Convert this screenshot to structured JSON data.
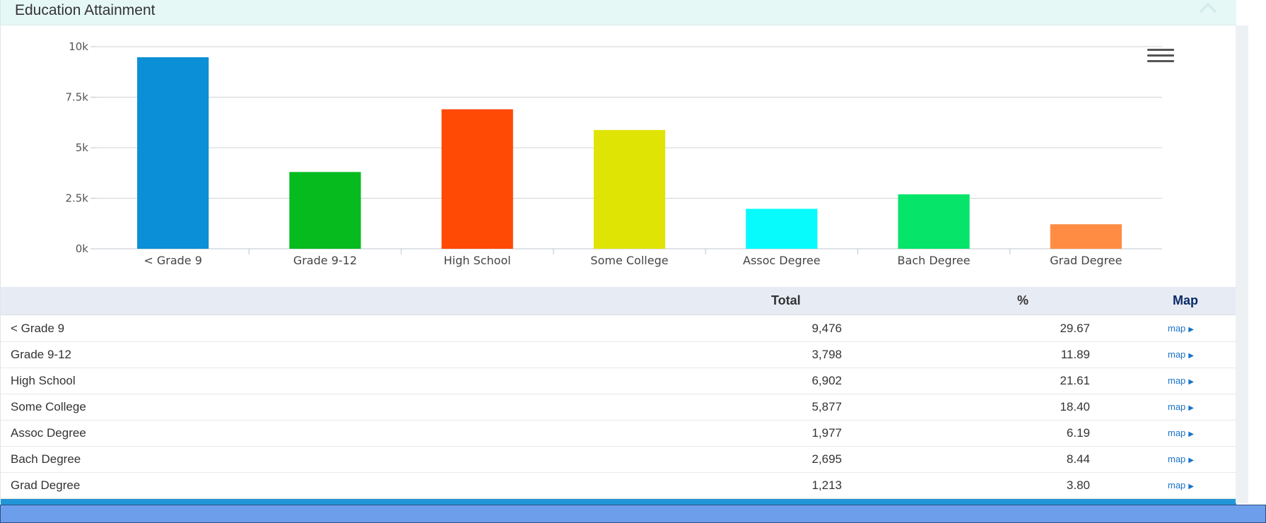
{
  "panel": {
    "title": "Education Attainment",
    "icons": {
      "collapse": "chevron-up-icon",
      "menu": "hamburger-menu-icon"
    }
  },
  "chart_data": {
    "type": "bar",
    "categories": [
      "< Grade 9",
      "Grade 9-12",
      "High School",
      "Some College",
      "Assoc Degree",
      "Bach Degree",
      "Grad Degree"
    ],
    "values": [
      9476,
      3798,
      6902,
      5877,
      1977,
      2695,
      1213
    ],
    "colors": [
      "#0b8fd6",
      "#05bb1e",
      "#ff4a05",
      "#dfe405",
      "#07fbfd",
      "#06e46a",
      "#ff8c42"
    ],
    "yticks": [
      0,
      2500,
      5000,
      7500,
      10000
    ],
    "ytick_labels": [
      "0k",
      "2.5k",
      "5k",
      "7.5k",
      "10k"
    ],
    "ylim": [
      0,
      10000
    ],
    "grid": true,
    "legend": "none"
  },
  "table": {
    "headers": {
      "name": "",
      "total": "Total",
      "pct": "%",
      "map": "Map"
    },
    "rows": [
      {
        "name": "< Grade 9",
        "total": "9,476",
        "pct": "29.67",
        "map": "map"
      },
      {
        "name": "Grade 9-12",
        "total": "3,798",
        "pct": "11.89",
        "map": "map"
      },
      {
        "name": "High School",
        "total": "6,902",
        "pct": "21.61",
        "map": "map"
      },
      {
        "name": "Some College",
        "total": "5,877",
        "pct": "18.40",
        "map": "map"
      },
      {
        "name": "Assoc Degree",
        "total": "1,977",
        "pct": "6.19",
        "map": "map"
      },
      {
        "name": "Bach Degree",
        "total": "2,695",
        "pct": "8.44",
        "map": "map"
      },
      {
        "name": "Grad Degree",
        "total": "1,213",
        "pct": "3.80",
        "map": "map"
      }
    ]
  },
  "colors": {
    "header_bg": "#e6f8f6",
    "table_header_bg": "#e7ebf3",
    "accent": "#2196d6",
    "footer": "#6d9eeb"
  }
}
